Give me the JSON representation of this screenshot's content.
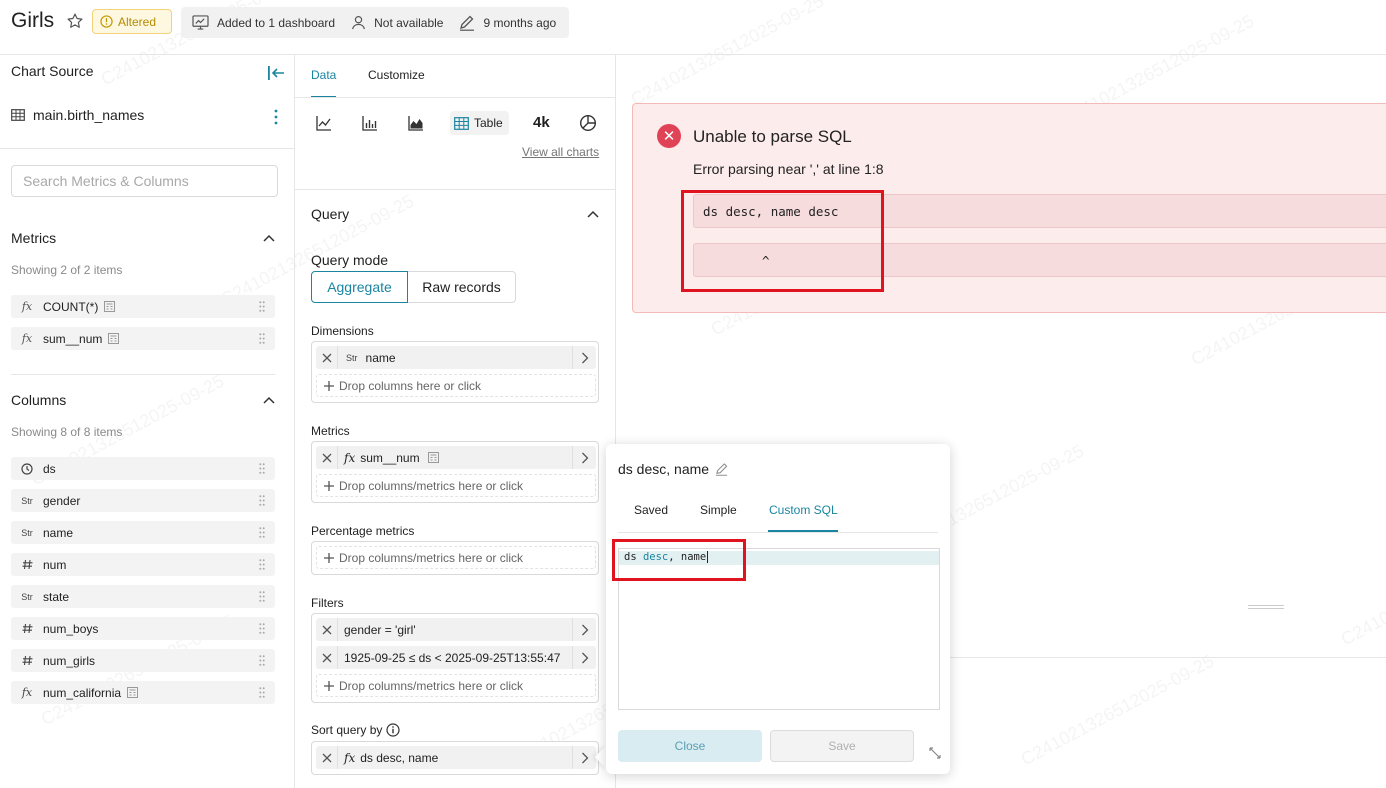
{
  "header": {
    "title": "Girls",
    "altered_label": "Altered",
    "dashboards_label": "Added to 1 dashboard",
    "owner_label": "Not available",
    "modified_label": "9 months ago"
  },
  "left_panel": {
    "title": "Chart Source",
    "datasource": "main.birth_names",
    "search_placeholder": "Search Metrics & Columns",
    "metrics_title": "Metrics",
    "metrics_showing": "Showing 2 of 2 items",
    "metrics": [
      {
        "type": "fx",
        "name": "COUNT(*)"
      },
      {
        "type": "fx",
        "name": "sum__num"
      }
    ],
    "columns_title": "Columns",
    "columns_showing": "Showing 8 of 8 items",
    "columns": [
      {
        "type": "clock",
        "name": "ds"
      },
      {
        "type": "Str",
        "name": "gender"
      },
      {
        "type": "Str",
        "name": "name"
      },
      {
        "type": "#",
        "name": "num"
      },
      {
        "type": "Str",
        "name": "state"
      },
      {
        "type": "#",
        "name": "num_boys"
      },
      {
        "type": "#",
        "name": "num_girls"
      },
      {
        "type": "fx",
        "name": "num_california"
      }
    ]
  },
  "middle_panel": {
    "tabs": [
      "Data",
      "Customize"
    ],
    "viz_table_label": "Table",
    "viz_bignumber_label": "4k",
    "view_all": "View all charts",
    "query_title": "Query",
    "query_mode_label": "Query mode",
    "query_modes": [
      "Aggregate",
      "Raw records"
    ],
    "dimensions_label": "Dimensions",
    "dimension_value": "name",
    "dimension_type": "Str",
    "drop_columns": "Drop columns here or click",
    "metrics_label": "Metrics",
    "metric_value": "sum__num",
    "drop_metrics": "Drop columns/metrics here or click",
    "percentage_label": "Percentage metrics",
    "filters_label": "Filters",
    "filters": [
      "gender = 'girl'",
      "1925-09-25 ≤ ds < 2025-09-25T13:55:47"
    ],
    "sort_label": "Sort query by",
    "sort_value": "ds desc, name"
  },
  "error": {
    "title": "Unable to parse SQL",
    "message": "Error parsing near ',' at line 1:8",
    "code_line": "ds desc, name desc",
    "caret_line": "^"
  },
  "popover": {
    "title": "ds desc, name",
    "tabs": [
      "Saved",
      "Simple",
      "Custom SQL"
    ],
    "sql_token_1": "ds ",
    "sql_token_2": "desc",
    "sql_token_3": ", name",
    "close_label": "Close",
    "save_label": "Save"
  },
  "watermark": "C241021326512025-09-25",
  "colors": {
    "accent": "#1a85a0",
    "error": "#e04355",
    "error_bg": "#fdecec",
    "highlight_box": "#e0141e"
  }
}
